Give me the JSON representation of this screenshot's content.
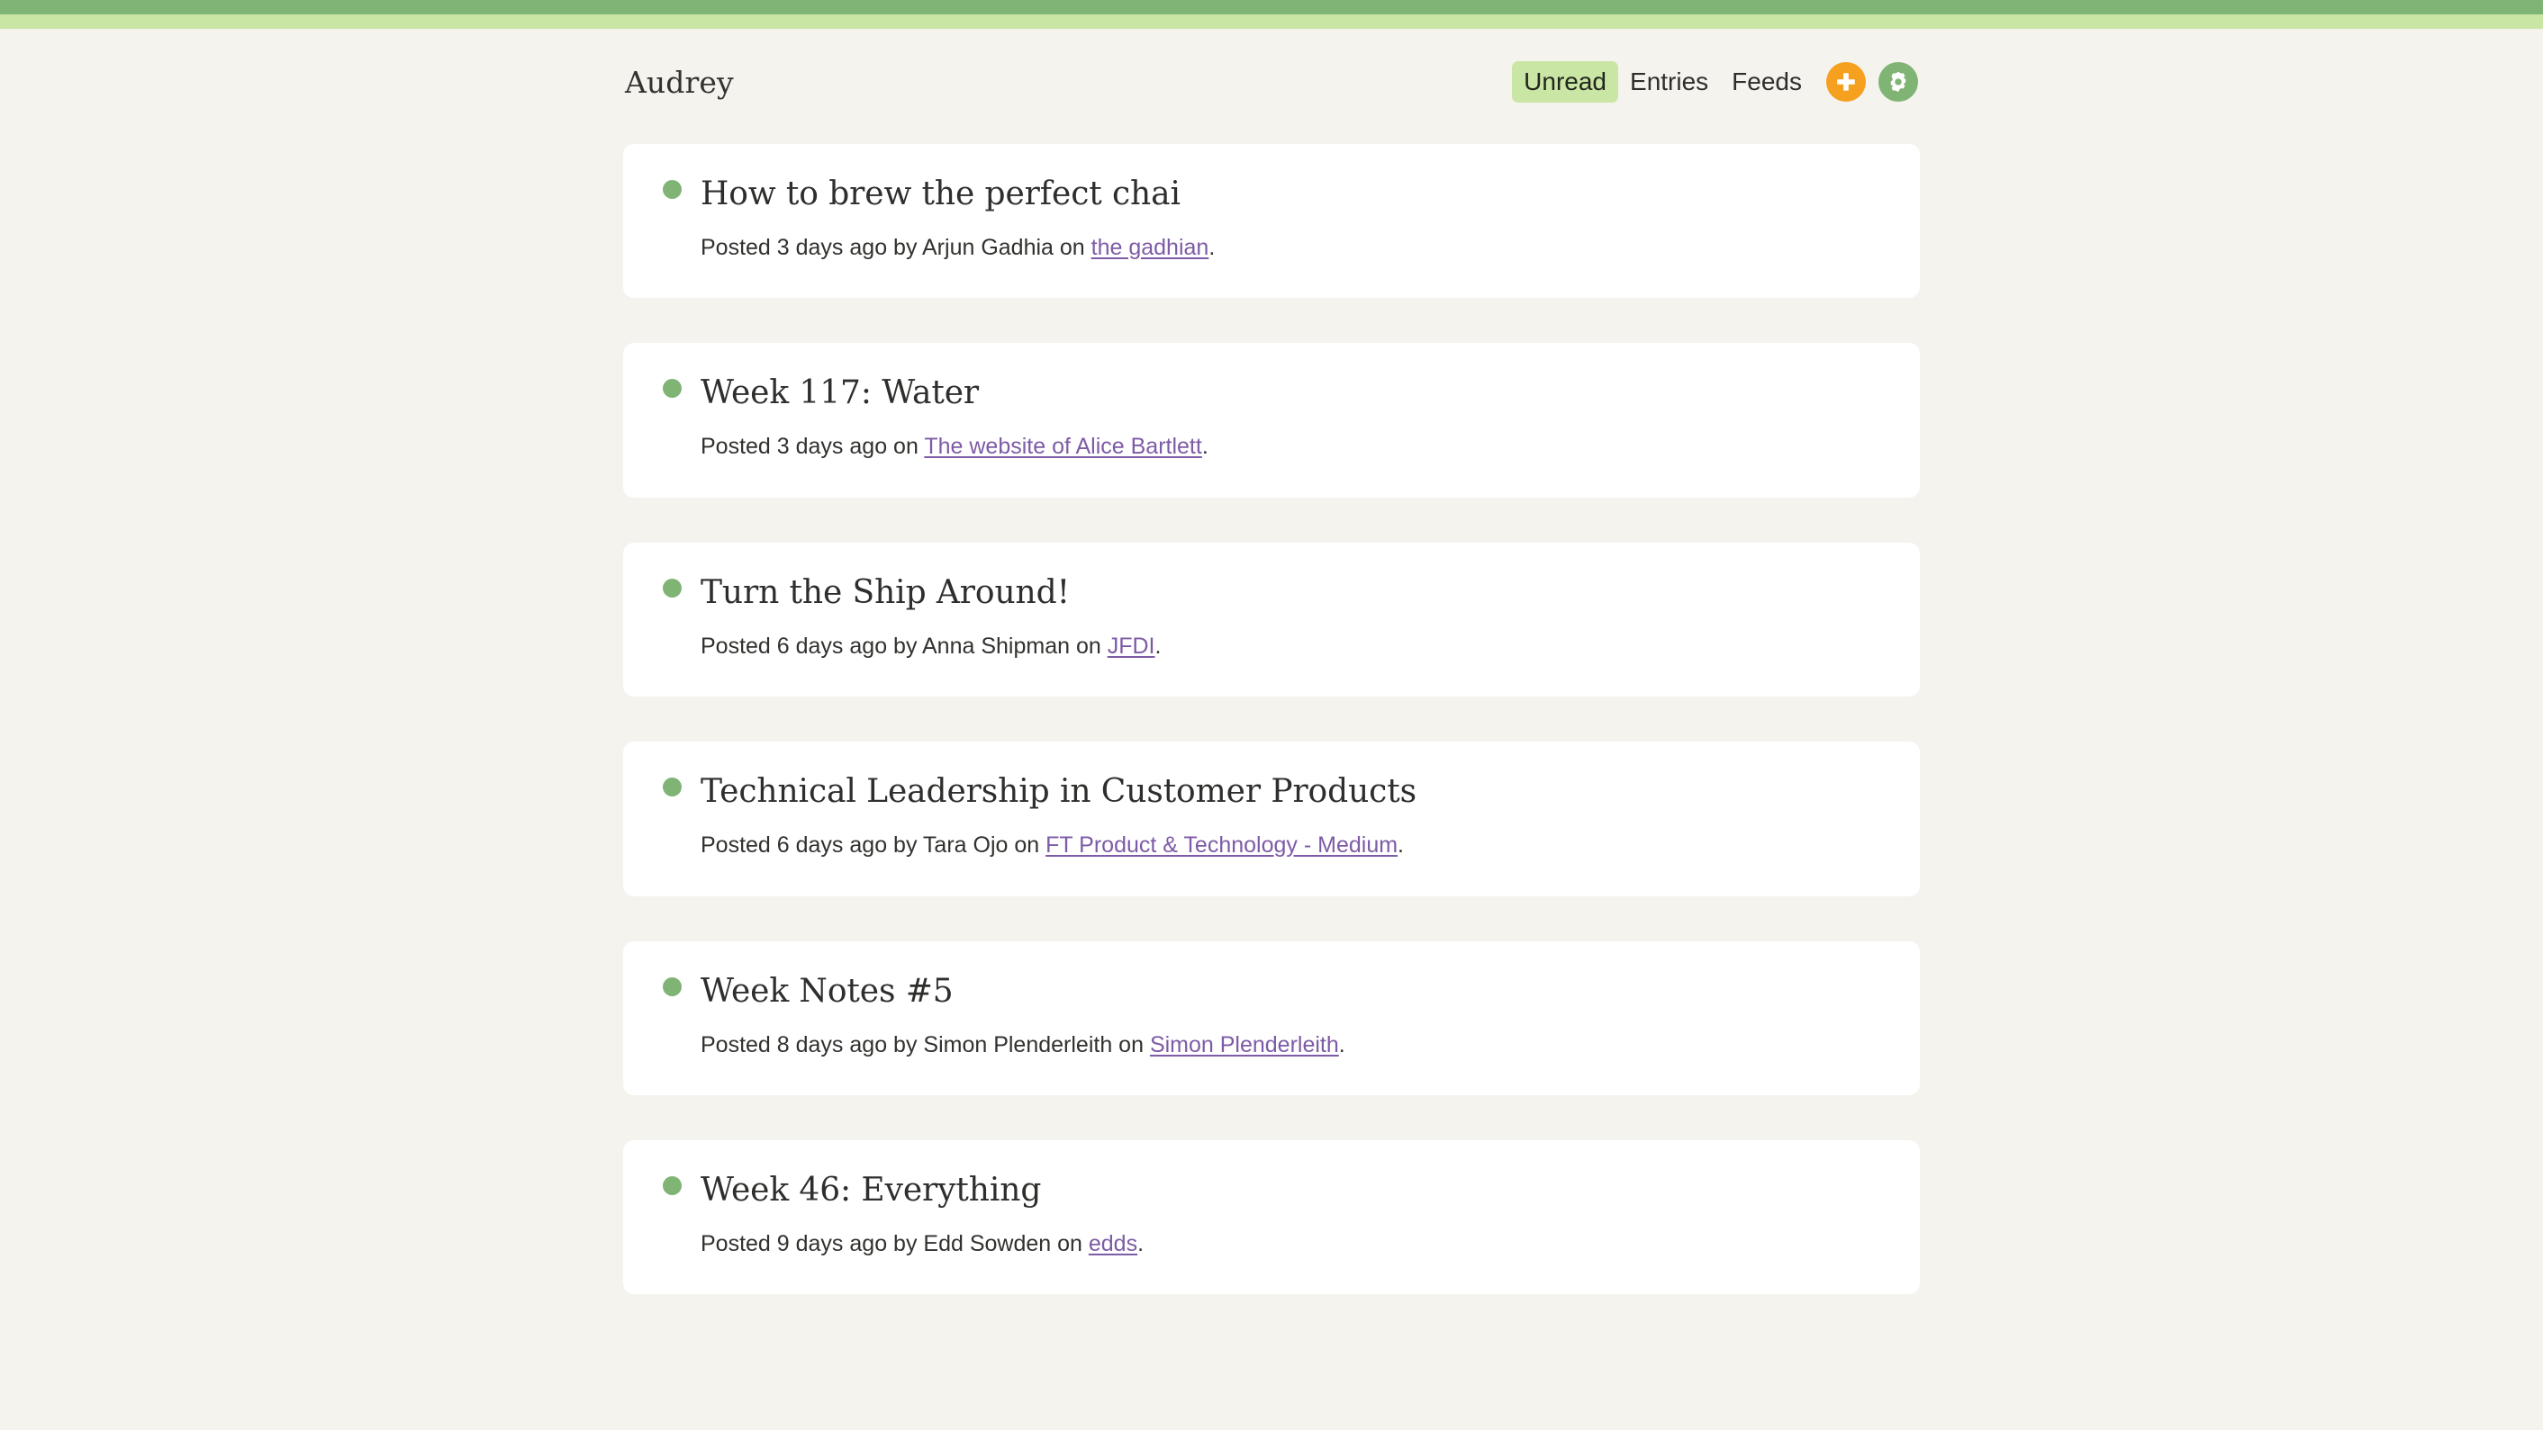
{
  "theme": {
    "stripe_dark": "#7fb474",
    "stripe_light": "#c9e6a4",
    "page_background": "#f4f3ee",
    "card_background": "#ffffff",
    "accent_orange": "#f5a01e",
    "accent_green": "#7fb474",
    "link_purple": "#7d5ba6",
    "text_color": "#2f2e2c"
  },
  "header": {
    "title": "Audrey",
    "nav": [
      {
        "label": "Unread",
        "active": true,
        "name": "nav-unread"
      },
      {
        "label": "Entries",
        "active": false,
        "name": "nav-entries"
      },
      {
        "label": "Feeds",
        "active": false,
        "name": "nav-feeds"
      }
    ],
    "actions": [
      {
        "icon": "plus-icon",
        "name": "add-feed-button",
        "color": "#f5a01e"
      },
      {
        "icon": "gear-icon",
        "name": "settings-button",
        "color": "#7fb474"
      }
    ]
  },
  "entries": [
    {
      "title": "How to brew the perfect chai",
      "unread": true,
      "meta_prefix": "Posted 3 days ago by Arjun Gadhia on ",
      "feed": "the gadhian",
      "meta_suffix": "."
    },
    {
      "title": "Week 117: Water",
      "unread": true,
      "meta_prefix": "Posted 3 days ago on ",
      "feed": "The website of Alice Bartlett",
      "meta_suffix": "."
    },
    {
      "title": "Turn the Ship Around!",
      "unread": true,
      "meta_prefix": "Posted 6 days ago by Anna Shipman on ",
      "feed": "JFDI",
      "meta_suffix": "."
    },
    {
      "title": "Technical Leadership in Customer Products",
      "unread": true,
      "meta_prefix": "Posted 6 days ago by Tara Ojo on ",
      "feed": "FT Product & Technology - Medium",
      "meta_suffix": "."
    },
    {
      "title": "Week Notes #5",
      "unread": true,
      "meta_prefix": "Posted 8 days ago by Simon Plenderleith on ",
      "feed": "Simon Plenderleith",
      "meta_suffix": "."
    },
    {
      "title": "Week 46: Everything",
      "unread": true,
      "meta_prefix": "Posted 9 days ago by Edd Sowden on ",
      "feed": "edds",
      "meta_suffix": "."
    }
  ]
}
